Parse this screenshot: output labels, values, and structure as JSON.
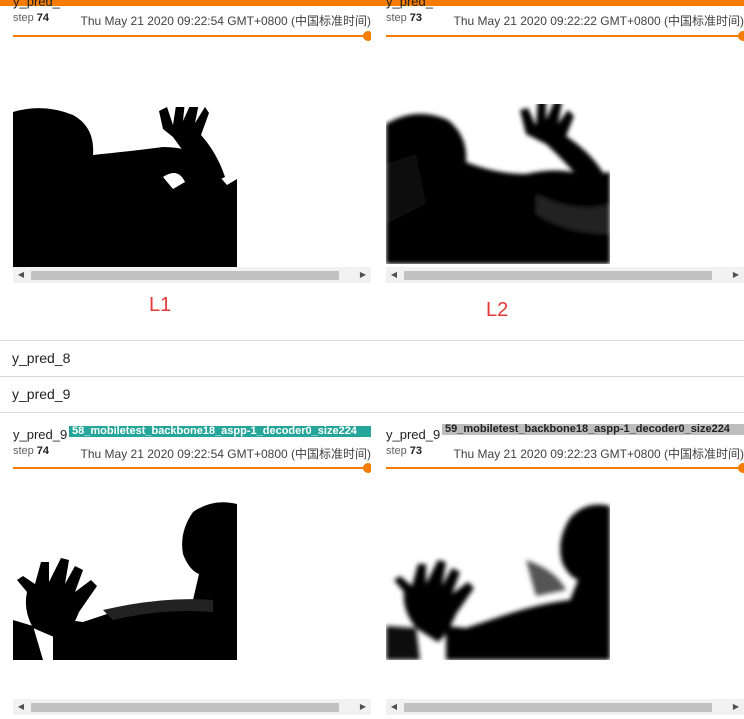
{
  "colors": {
    "accent": "#f57c00",
    "run_badge_teal": "#26a69a",
    "run_badge_gray": "#bdbdbd",
    "annotation_red": "#e53935"
  },
  "cards_top": [
    {
      "title": "y_pred_",
      "step_label": "step",
      "step": "74",
      "timestamp": "Thu May 21 2020 09:22:54 GMT+0800 (中国标准时间)"
    },
    {
      "title": "y_pred_",
      "step_label": "step",
      "step": "73",
      "timestamp": "Thu May 21 2020 09:22:22 GMT+0800 (中国标准时间)"
    }
  ],
  "annotations": {
    "left": "L1",
    "right": "L2"
  },
  "sections": [
    {
      "label": "y_pred_8"
    },
    {
      "label": "y_pred_9"
    }
  ],
  "cards_bottom": [
    {
      "title": "y_pred_9",
      "run": "58_mobiletest_backbone18_aspp-1_decoder0_size224",
      "step_label": "step",
      "step": "74",
      "timestamp": "Thu May 21 2020 09:22:54 GMT+0800 (中国标准时间)"
    },
    {
      "title": "y_pred_9",
      "run": "59_mobiletest_backbone18_aspp-1_decoder0_size224",
      "step_label": "step",
      "step": "73",
      "timestamp": "Thu May 21 2020 09:22:23 GMT+0800 (中国标准时间)"
    }
  ],
  "icons": {
    "scroll_left": "◀",
    "scroll_right": "▶"
  }
}
